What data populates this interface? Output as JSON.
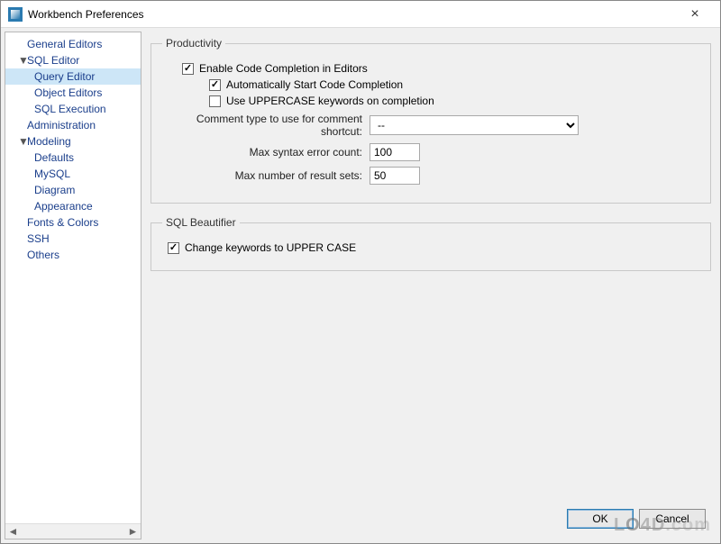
{
  "window": {
    "title": "Workbench Preferences"
  },
  "sidebar": {
    "items": [
      {
        "label": "General Editors",
        "level": 1,
        "selected": false,
        "caret": ""
      },
      {
        "label": "SQL Editor",
        "level": 1,
        "selected": false,
        "caret": "▼"
      },
      {
        "label": "Query Editor",
        "level": 2,
        "selected": true,
        "caret": ""
      },
      {
        "label": "Object Editors",
        "level": 2,
        "selected": false,
        "caret": ""
      },
      {
        "label": "SQL Execution",
        "level": 2,
        "selected": false,
        "caret": ""
      },
      {
        "label": "Administration",
        "level": 1,
        "selected": false,
        "caret": ""
      },
      {
        "label": "Modeling",
        "level": 1,
        "selected": false,
        "caret": "▼"
      },
      {
        "label": "Defaults",
        "level": 2,
        "selected": false,
        "caret": ""
      },
      {
        "label": "MySQL",
        "level": 2,
        "selected": false,
        "caret": ""
      },
      {
        "label": "Diagram",
        "level": 2,
        "selected": false,
        "caret": ""
      },
      {
        "label": "Appearance",
        "level": 2,
        "selected": false,
        "caret": ""
      },
      {
        "label": "Fonts & Colors",
        "level": 1,
        "selected": false,
        "caret": ""
      },
      {
        "label": "SSH",
        "level": 1,
        "selected": false,
        "caret": ""
      },
      {
        "label": "Others",
        "level": 1,
        "selected": false,
        "caret": ""
      }
    ]
  },
  "groups": {
    "productivity": {
      "legend": "Productivity",
      "enable_code_completion": {
        "label": "Enable Code Completion in Editors",
        "checked": true
      },
      "auto_start": {
        "label": "Automatically Start Code Completion",
        "checked": true
      },
      "uppercase_keywords": {
        "label": "Use UPPERCASE keywords on completion",
        "checked": false
      },
      "comment_type": {
        "label": "Comment type to use for comment shortcut:",
        "value": "--"
      },
      "max_syntax": {
        "label": "Max syntax error count:",
        "value": "100"
      },
      "max_resultsets": {
        "label": "Max number of result sets:",
        "value": "50"
      }
    },
    "beautifier": {
      "legend": "SQL Beautifier",
      "upper_case": {
        "label": "Change keywords to UPPER CASE",
        "checked": true
      }
    }
  },
  "buttons": {
    "ok": "OK",
    "cancel": "Cancel"
  },
  "watermark": "LO4D.com"
}
